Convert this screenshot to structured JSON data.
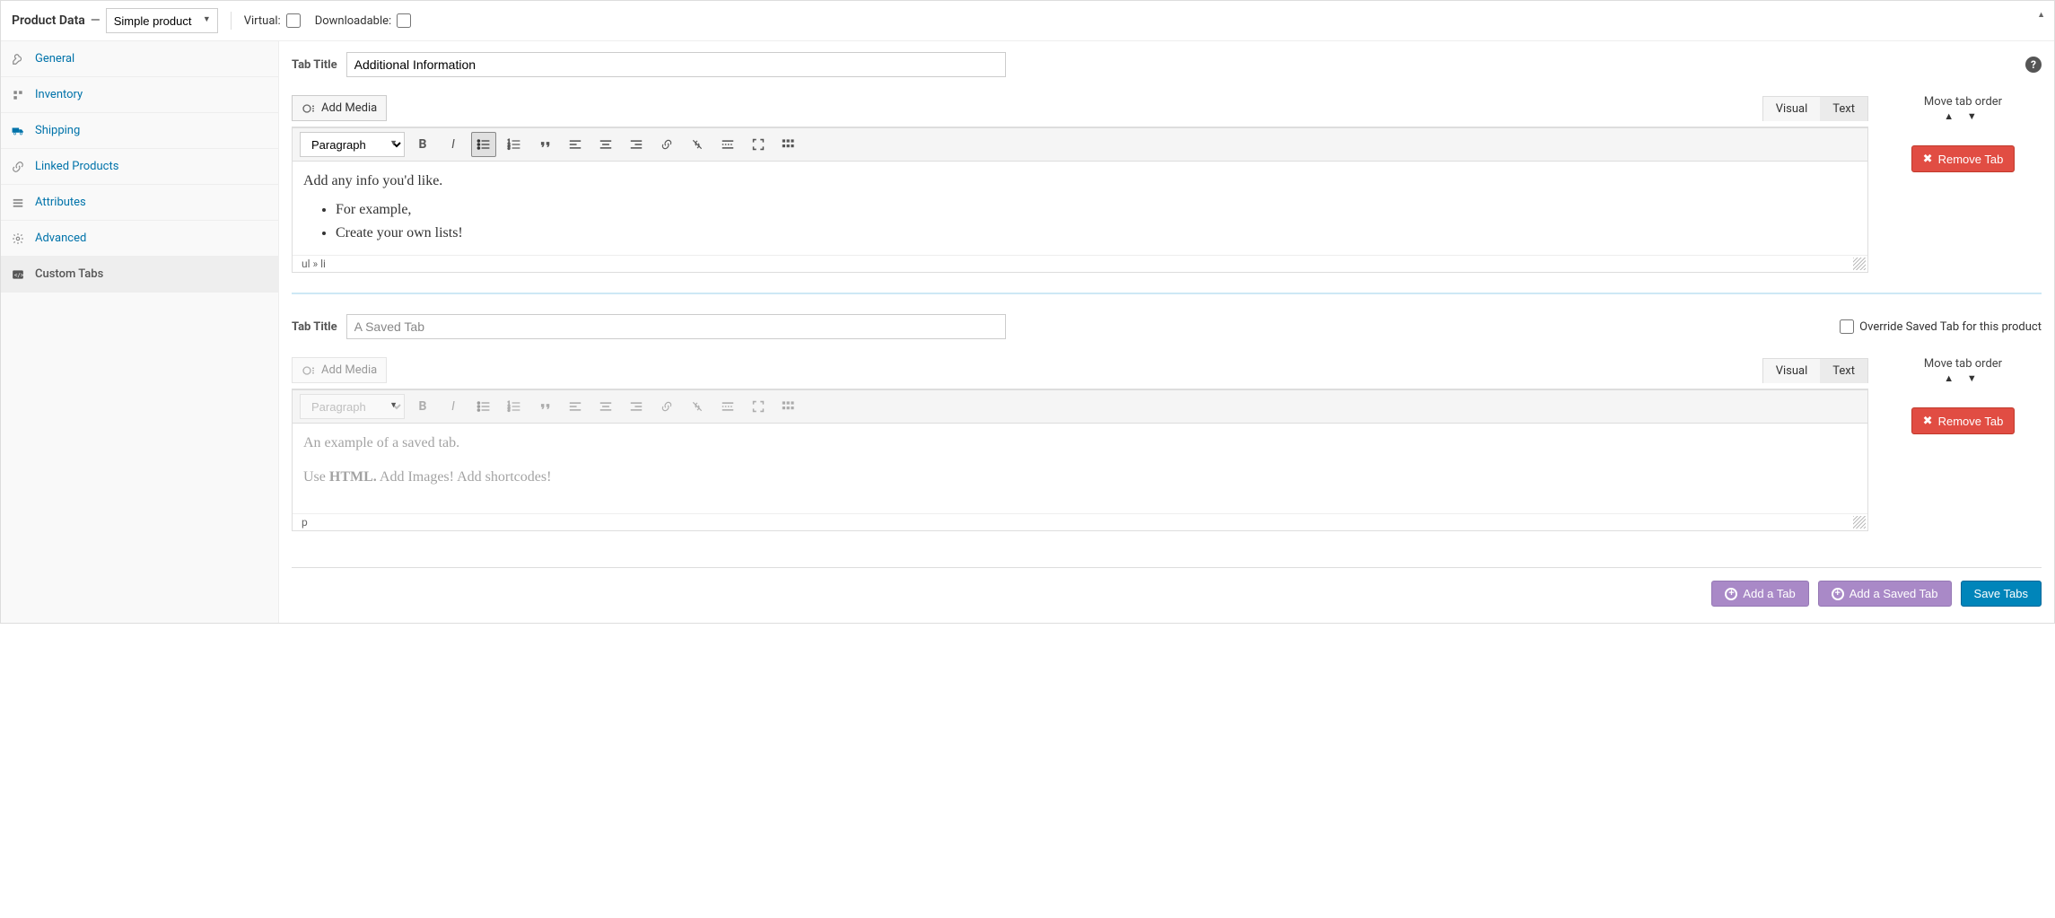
{
  "header": {
    "title": "Product Data",
    "product_type": "Simple product",
    "virtual_label": "Virtual:",
    "downloadable_label": "Downloadable:"
  },
  "sidebar": {
    "items": [
      {
        "label": "General"
      },
      {
        "label": "Inventory"
      },
      {
        "label": "Shipping"
      },
      {
        "label": "Linked Products"
      },
      {
        "label": "Attributes"
      },
      {
        "label": "Advanced"
      },
      {
        "label": "Custom Tabs"
      }
    ]
  },
  "editors": {
    "add_media": "Add Media",
    "visual": "Visual",
    "text": "Text",
    "paragraph": "Paragraph",
    "move_label": "Move tab order",
    "remove_label": "Remove Tab",
    "tab_title_label": "Tab Title"
  },
  "tab1": {
    "title_value": "Additional Information",
    "body_intro": "Add any info you'd like.",
    "list1": "For example,",
    "list2": "Create your own lists!",
    "status": "ul » li"
  },
  "tab2": {
    "title_value": "A Saved Tab",
    "override_label": "Override Saved Tab for this product",
    "body_p1_a": "An example of a saved tab.",
    "body_p2_a": "Use ",
    "body_p2_b": "HTML.",
    "body_p2_c": " Add Images! Add shortcodes!",
    "status": "p"
  },
  "actions": {
    "add_tab": "Add a Tab",
    "add_saved": "Add a Saved Tab",
    "save": "Save Tabs"
  }
}
